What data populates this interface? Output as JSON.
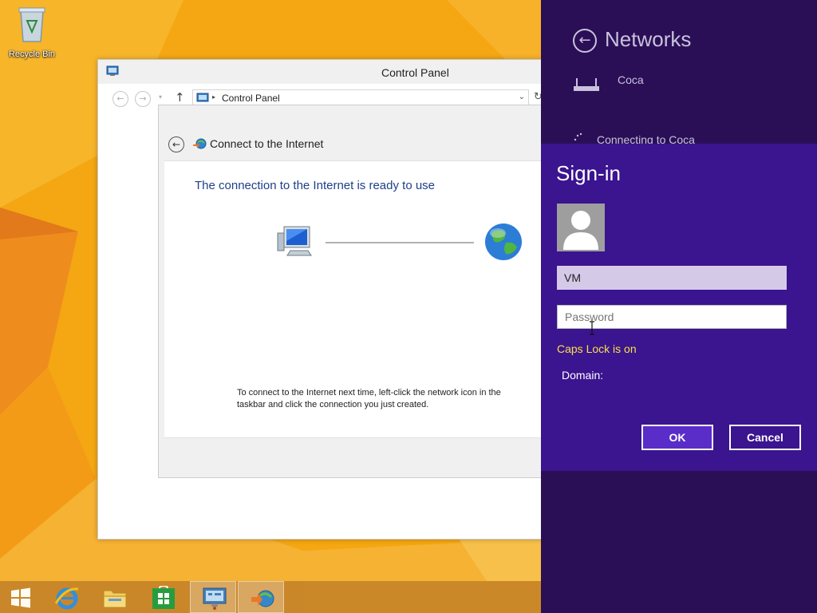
{
  "desktop": {
    "recycle_bin_label": "Recycle Bin"
  },
  "control_panel": {
    "title": "Control Panel",
    "address_path": "Control Panel",
    "back_icon": "arrow-left-icon",
    "forward_icon": "arrow-right-icon",
    "up_icon": "arrow-up-icon"
  },
  "wizard": {
    "header": "Connect to the Internet",
    "heading": "The connection to the Internet is ready to use",
    "note": "To connect to the Internet next time, left-click the network icon in the taskbar and click the connection you just created."
  },
  "networks": {
    "title": "Networks",
    "network_name": "Coca",
    "status": "Connecting to Coca"
  },
  "signin": {
    "title": "Sign-in",
    "username": "VM",
    "password_placeholder": "Password",
    "caps_lock_warning": "Caps Lock is on",
    "domain_label": "Domain:",
    "ok_label": "OK",
    "cancel_label": "Cancel"
  },
  "taskbar": {
    "items": [
      "start-icon",
      "internet-explorer-icon",
      "file-explorer-icon",
      "store-icon",
      "control-panel-icon",
      "network-connection-icon"
    ]
  },
  "colors": {
    "charm_bg": "#2a0f57",
    "signin_bg": "#3b148f",
    "caps_warning": "#f7e04a",
    "wallpaper": "#f2a10e"
  }
}
